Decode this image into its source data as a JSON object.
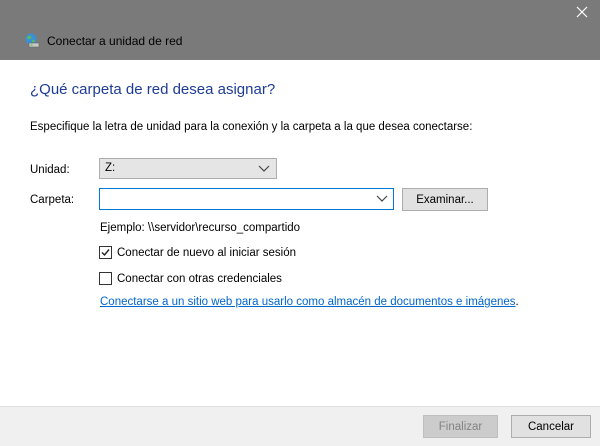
{
  "window": {
    "title": "Conectar a unidad de red",
    "icon": "network-drive-icon",
    "close_icon": "close-icon"
  },
  "heading": "¿Qué carpeta de red desea asignar?",
  "instruction": "Especifique la letra de unidad para la conexión y la carpeta a la que desea conectarse:",
  "drive": {
    "label": "Unidad:",
    "value": "Z:"
  },
  "folder": {
    "label": "Carpeta:",
    "value": "",
    "browse_label": "Examinar..."
  },
  "example": "Ejemplo: \\\\servidor\\recurso_compartido",
  "options": {
    "reconnect": {
      "label": "Conectar de nuevo al iniciar sesión",
      "checked": true
    },
    "other_credentials": {
      "label": "Conectar con otras credenciales",
      "checked": false
    }
  },
  "link": {
    "text": "Conectarse a un sitio web para usarlo como almacén de documentos e imágenes",
    "suffix": "."
  },
  "footer": {
    "finish_label": "Finalizar",
    "finish_enabled": false,
    "cancel_label": "Cancelar"
  },
  "colors": {
    "titlebar": "#7a7a7a",
    "heading": "#1e3c96",
    "link": "#0066cc",
    "focus_border": "#0078d7"
  }
}
